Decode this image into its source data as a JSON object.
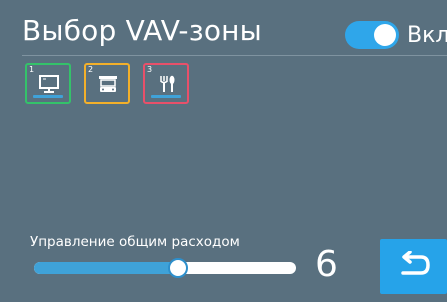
{
  "header": {
    "title": "Выбор VAV-зоны",
    "toggle_label": "Вкл",
    "toggle_on": true
  },
  "zones": [
    {
      "number": "1",
      "icon": "monitor-icon",
      "color": "#34c26a",
      "selected": true
    },
    {
      "number": "2",
      "icon": "cinema-screen-icon",
      "color": "#f3b02a",
      "selected": false
    },
    {
      "number": "3",
      "icon": "fork-knife-icon",
      "color": "#e8506a",
      "selected": false
    }
  ],
  "flow_control": {
    "label": "Управление общим расходом",
    "value": "6",
    "slider_fraction": 0.55
  },
  "colors": {
    "background": "#59707f",
    "accent": "#2fa6ea"
  },
  "back_button": {
    "icon": "back-arrow-icon"
  }
}
